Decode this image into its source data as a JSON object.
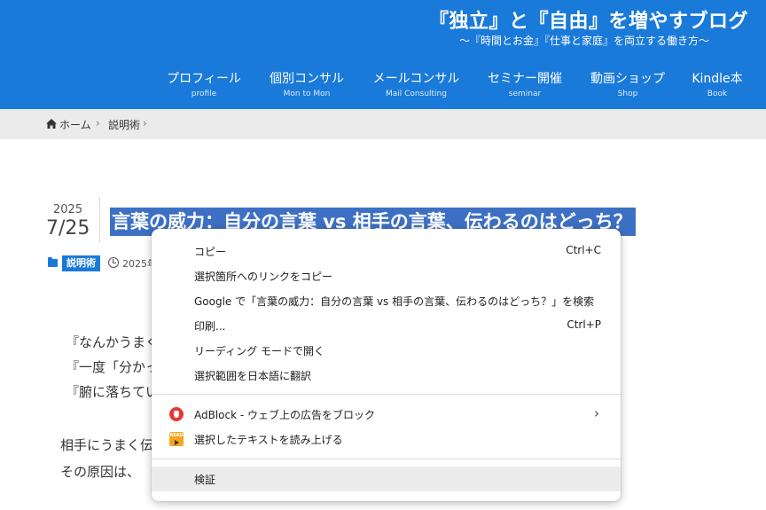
{
  "header": {
    "site_title": "『独立』と『自由』を増やすブログ",
    "tagline": "～『時間とお金』『仕事と家庭』を両立する働き方～",
    "nav": [
      {
        "jp": "プロフィール",
        "en": "profile"
      },
      {
        "jp": "個別コンサル",
        "en": "Mon to Mon"
      },
      {
        "jp": "メールコンサル",
        "en": "Mail Consulting"
      },
      {
        "jp": "セミナー開催",
        "en": "seminar"
      },
      {
        "jp": "動画ショップ",
        "en": "Shop"
      },
      {
        "jp": "Kindle本",
        "en": "Book"
      }
    ]
  },
  "breadcrumb": {
    "home": "ホーム",
    "sep1": "›",
    "category": "説明術",
    "sep2": "›"
  },
  "post": {
    "year": "2025",
    "month_day": "7/25",
    "title": "言葉の威力：自分の言葉 vs 相手の言葉、伝わるのはどっち？",
    "category": "説明術",
    "published": "2025年",
    "body_lines": [
      "『なんかうまく",
      "『一度「分かっ",
      "『腑に落ちてい",
      "相手にうまく伝",
      "その原因は、"
    ]
  },
  "context_menu": {
    "items": [
      {
        "label": "コピー",
        "shortcut": "Ctrl+C"
      },
      {
        "label": "選択箇所へのリンクをコピー"
      },
      {
        "label": "Google で「言葉の威力：自分の言葉 vs 相手の言葉、伝わるのはどっち？」を検索"
      },
      {
        "label": "印刷...",
        "shortcut": "Ctrl+P"
      },
      {
        "label": "リーディング モードで開く"
      },
      {
        "label": "選択範囲を日本語に翻訳"
      },
      {
        "label": "AdBlock - ウェブ上の広告をブロック",
        "arrow": "›"
      },
      {
        "label": "選択したテキストを読み上げる",
        "icon_text": "READ"
      },
      {
        "label": "検証"
      }
    ]
  },
  "colors": {
    "header_bg": "#1a7ad9",
    "selection_bg": "#3d70c4",
    "badge_bg": "#1a7ad9",
    "menu_hover": "#ececec"
  }
}
